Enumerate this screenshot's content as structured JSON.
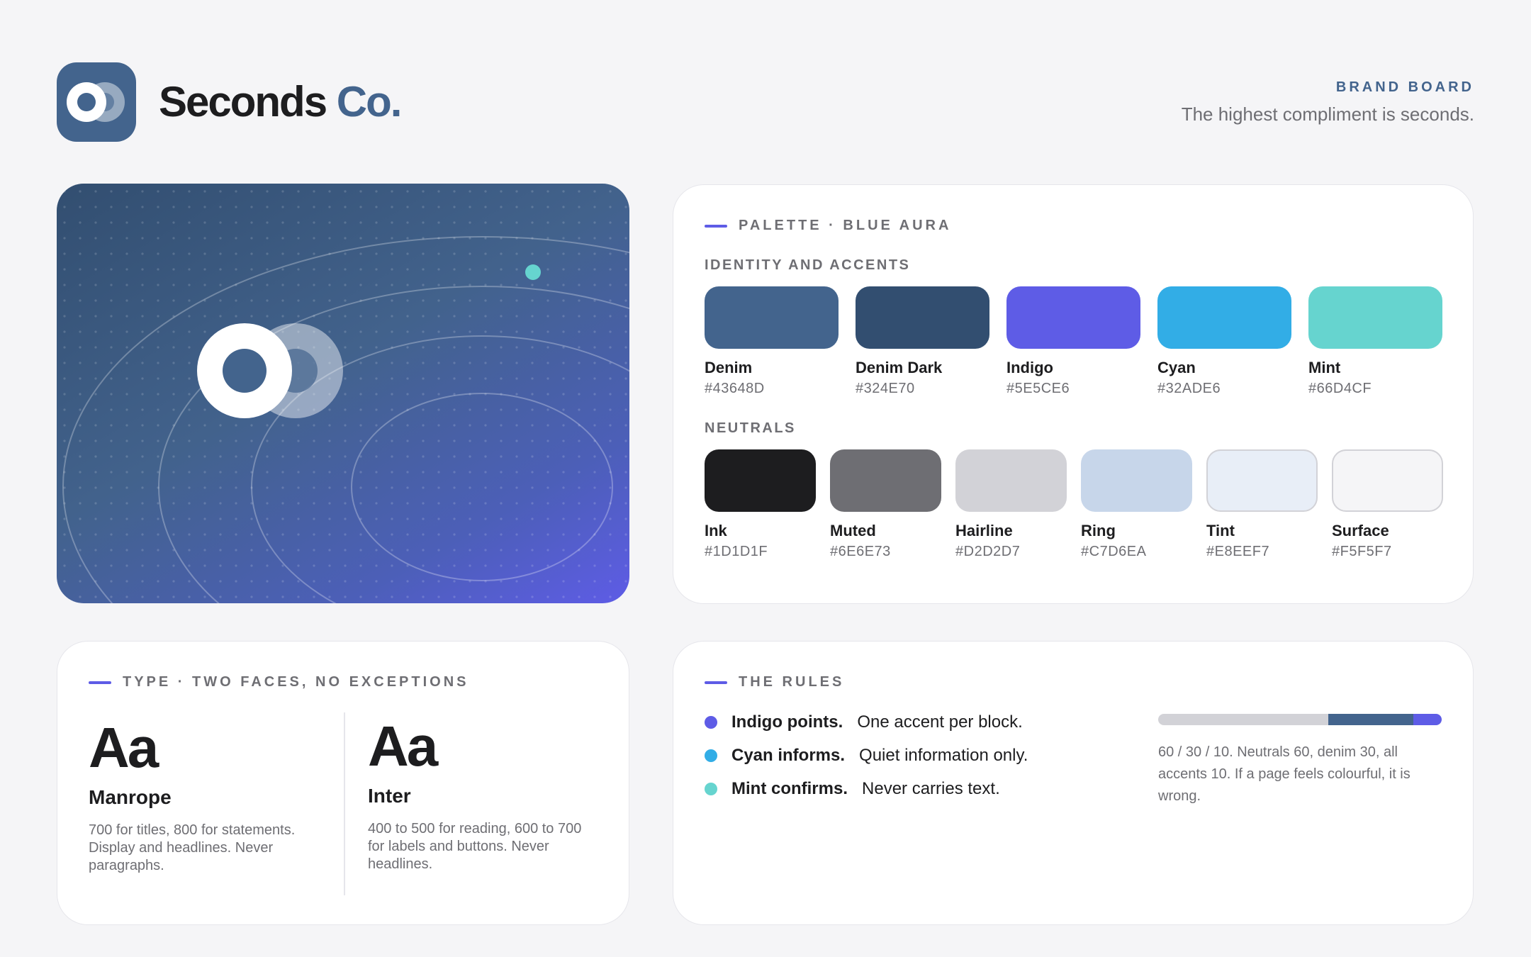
{
  "brand": {
    "name": "Seconds",
    "suffix": "Co.",
    "board_label": "BRAND BOARD",
    "tagline": "The highest compliment is seconds."
  },
  "palette": {
    "heading": "PALETTE · BLUE AURA",
    "identity_heading": "IDENTITY AND ACCENTS",
    "identity": [
      {
        "name": "Denim",
        "hex": "#43648D"
      },
      {
        "name": "Denim Dark",
        "hex": "#324E70"
      },
      {
        "name": "Indigo",
        "hex": "#5E5CE6"
      },
      {
        "name": "Cyan",
        "hex": "#32ADE6"
      },
      {
        "name": "Mint",
        "hex": "#66D4CF"
      }
    ],
    "neutrals_heading": "NEUTRALS",
    "neutrals": [
      {
        "name": "Ink",
        "hex": "#1D1D1F"
      },
      {
        "name": "Muted",
        "hex": "#6E6E73"
      },
      {
        "name": "Hairline",
        "hex": "#D2D2D7"
      },
      {
        "name": "Ring",
        "hex": "#C7D6EA"
      },
      {
        "name": "Tint",
        "hex": "#E8EEF7"
      },
      {
        "name": "Surface",
        "hex": "#F5F5F7"
      }
    ]
  },
  "type": {
    "heading": "TYPE · TWO FACES, NO EXCEPTIONS",
    "faces": [
      {
        "sample": "Aa",
        "name": "Manrope",
        "desc": "700 for titles, 800 for statements. Display and headlines. Never paragraphs."
      },
      {
        "sample": "Aa",
        "name": "Inter",
        "desc": "400 to 500 for reading, 600 to 700 for labels and buttons. Never headlines."
      }
    ]
  },
  "rules": {
    "heading": "THE RULES",
    "items": [
      {
        "bold": "Indigo points.",
        "text": "One accent per block.",
        "color": "#5E5CE6"
      },
      {
        "bold": "Cyan informs.",
        "text": "Quiet information only.",
        "color": "#32ADE6"
      },
      {
        "bold": "Mint confirms.",
        "text": "Never carries text.",
        "color": "#66D4CF"
      }
    ],
    "ratio": [
      {
        "share": 0.6,
        "color": "#D2D2D7"
      },
      {
        "share": 0.3,
        "color": "#43648D"
      },
      {
        "share": 0.1,
        "color": "#5E5CE6"
      }
    ],
    "note": "60 / 30 / 10. Neutrals 60, denim 30, all accents 10. If a page feels colourful, it is wrong."
  },
  "icons": {
    "logo": "double-ring-logo-icon",
    "hero_mark": "double-ring-mark-icon",
    "hero_dot": "orbit-dot-icon"
  }
}
